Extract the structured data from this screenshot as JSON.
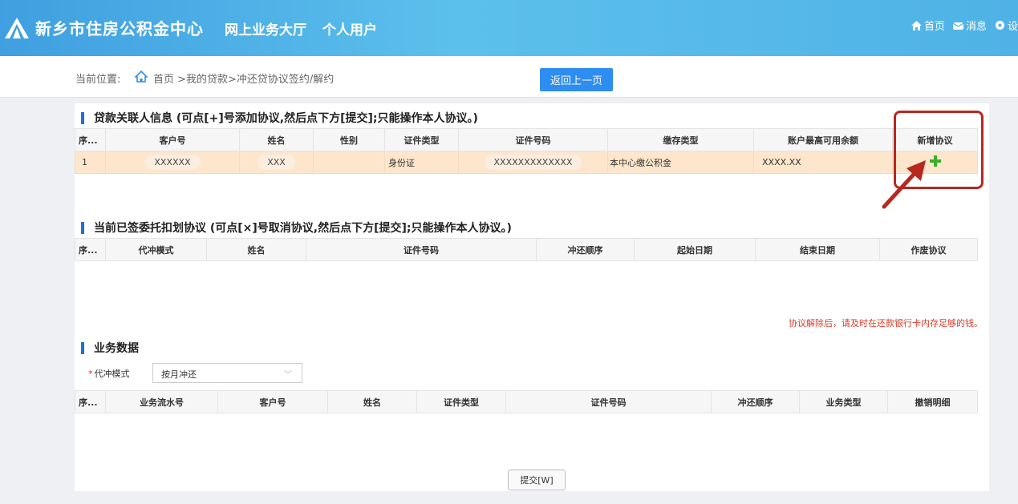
{
  "header": {
    "org_name": "新乡市住房公积金中心",
    "hall_name": "网上业务大厅",
    "user_type": "个人用户",
    "links": [
      {
        "icon": "home-icon",
        "label": "首页"
      },
      {
        "icon": "message-icon",
        "label": "消息"
      },
      {
        "icon": "gear-icon",
        "label": "设"
      }
    ]
  },
  "breadcrumb": {
    "label": "当前位置:",
    "path": "首页 >我的贷款>冲还贷协议签约/解约",
    "back_button": "返回上一页"
  },
  "section1": {
    "title": "贷款关联人信息 (可点[+]号添加协议,然后点下方[提交];只能操作本人协议。)",
    "columns": [
      "序...",
      "客户号",
      "姓名",
      "性别",
      "证件类型",
      "证件号码",
      "缴存类型",
      "账户最高可用余额",
      "新增协议"
    ],
    "rows": [
      {
        "seq": "1",
        "customer_no": "XXXXXX",
        "name": "XXX",
        "gender": "",
        "id_type": "身份证",
        "id_no": "XXXXXXXXXXXXX",
        "deposit_type": "本中心缴公积金",
        "balance": "XXXX.XX"
      }
    ]
  },
  "section2": {
    "title": "当前已签委托扣划协议 (可点[×]号取消协议,然后点下方[提交];只能操作本人协议。)",
    "columns": [
      "序...",
      "代冲模式",
      "姓名",
      "证件号码",
      "冲还顺序",
      "起始日期",
      "结束日期",
      "作废协议"
    ],
    "warning": "协议解除后，请及时在还款银行卡内存足够的钱。"
  },
  "section3": {
    "title": "业务数据",
    "mode_label": "代冲模式",
    "mode_value": "按月冲还",
    "columns": [
      "序...",
      "业务流水号",
      "客户号",
      "姓名",
      "证件类型",
      "证件号码",
      "冲还顺序",
      "业务类型",
      "撤销明细"
    ]
  },
  "submit_button": "提交[W]",
  "colors": {
    "header_bg": "#4fb2e6",
    "accent": "#2e8df0",
    "row_highlight": "#fde6cc",
    "annotation_red": "#b8281f",
    "plus_green": "#3dae2b"
  }
}
